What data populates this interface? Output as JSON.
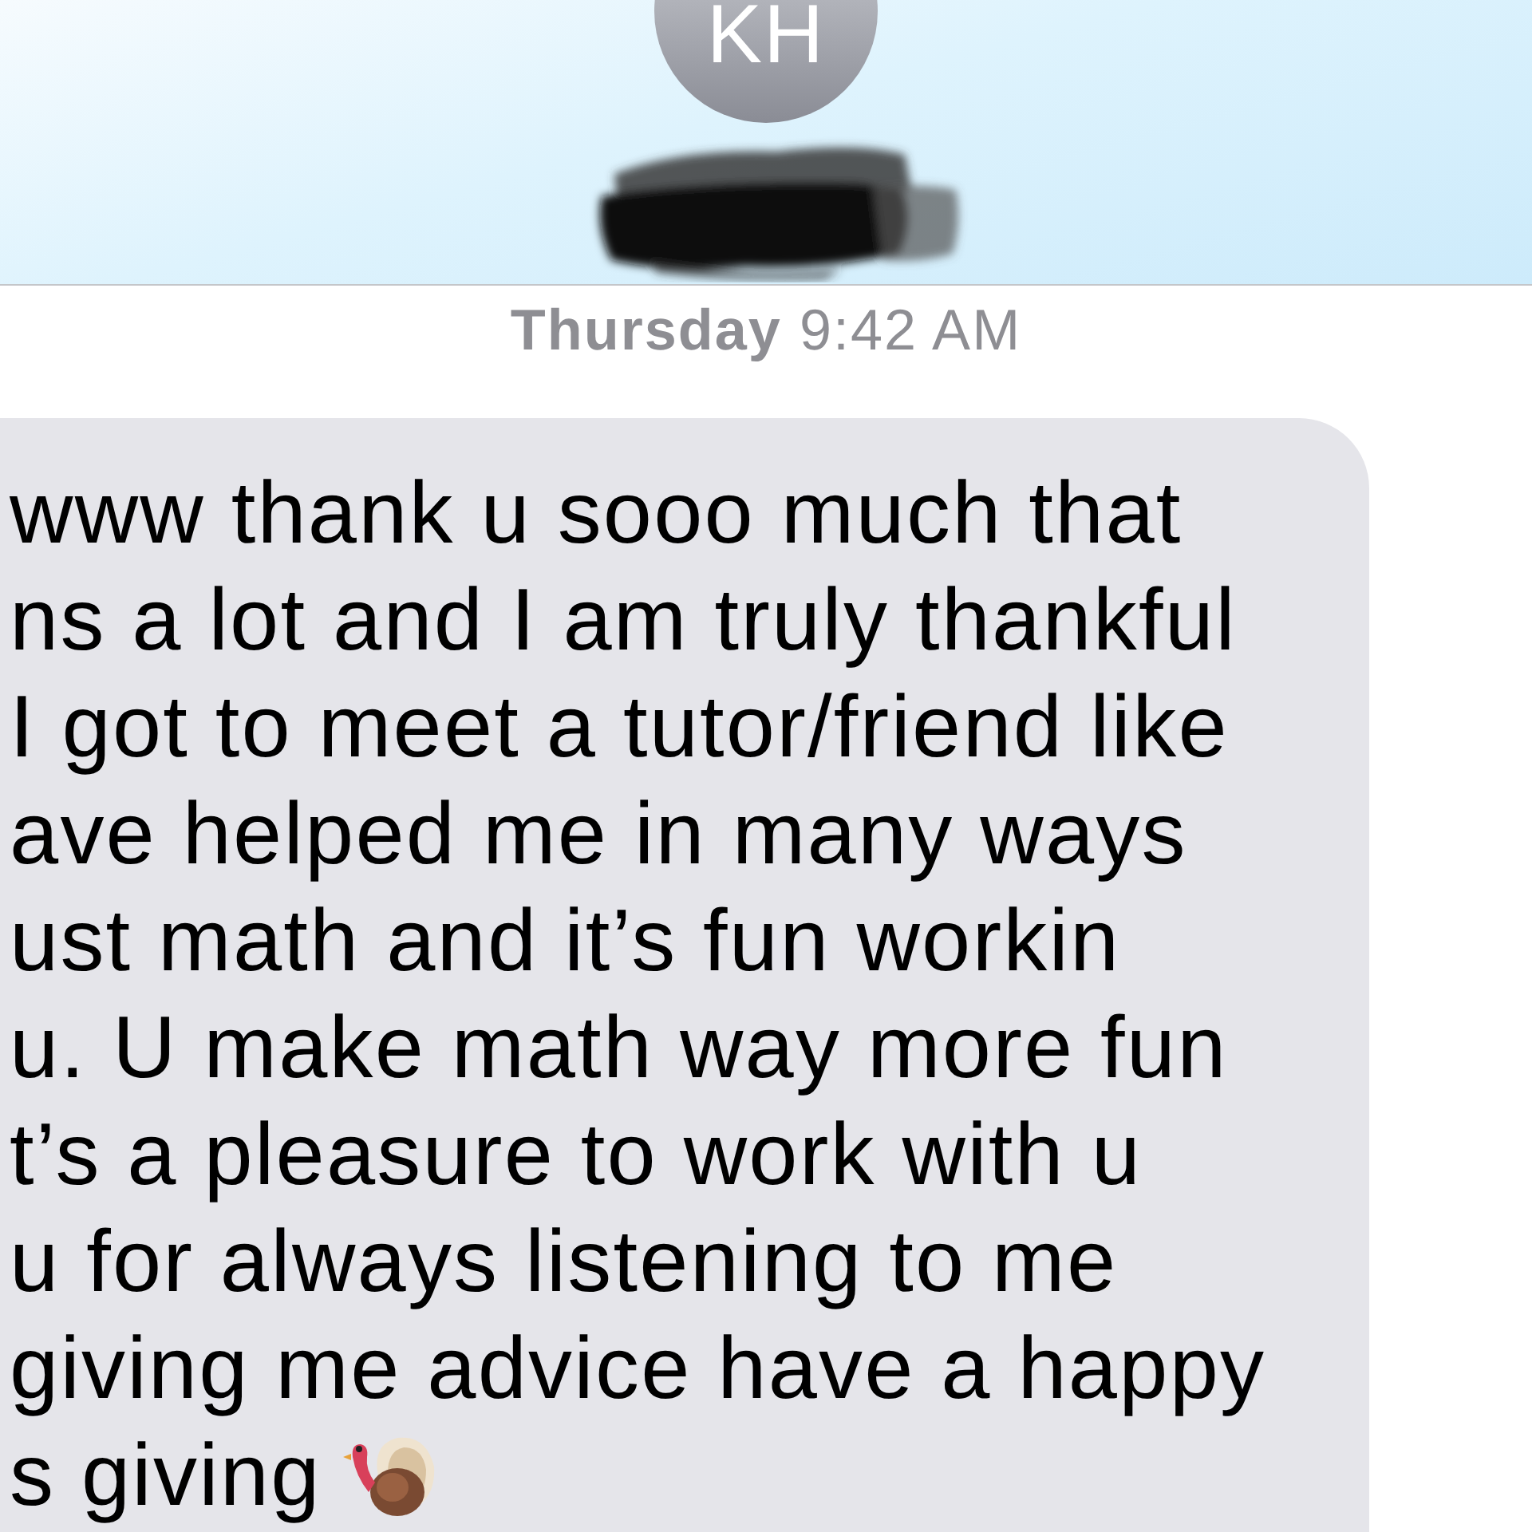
{
  "header": {
    "avatar_initials": "KH"
  },
  "timestamp": "**Thursday** 9:42 AM",
  "message": {
    "lines": [
      "www thank u sooo much that",
      "ns a lot and I am truly thankful",
      "I got to meet a tutor/friend like",
      "ave helped me in many ways",
      "ust math and it’s fun workin",
      "u. U make math way more fun",
      "t’s a pleasure to work with u",
      "u for always listening to me",
      "giving me advice have a happy",
      "s giving"
    ]
  }
}
